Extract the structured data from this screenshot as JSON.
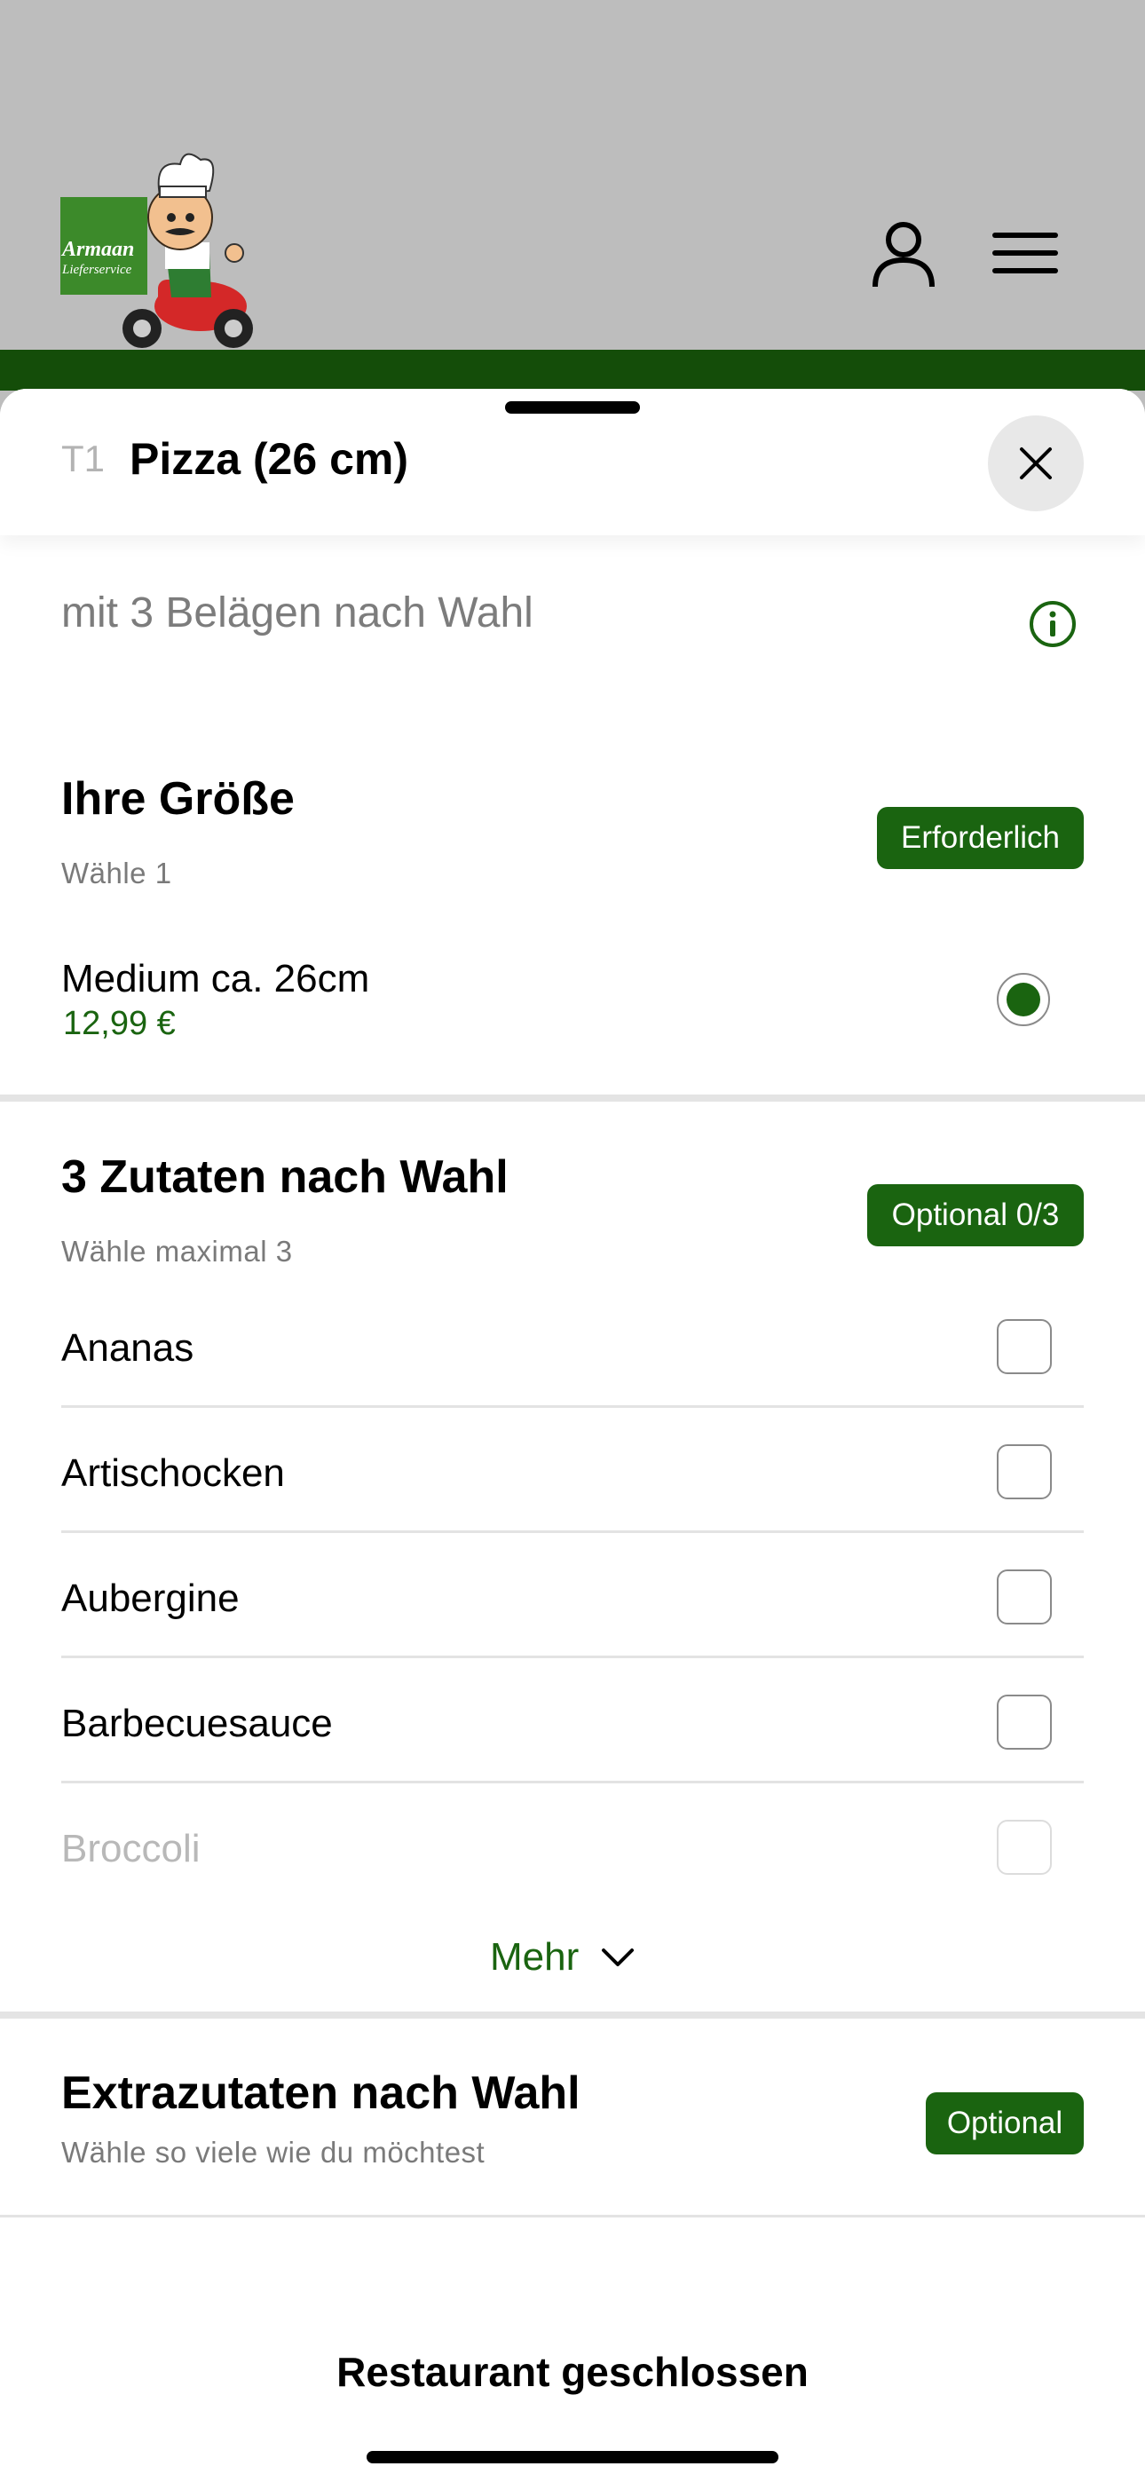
{
  "logo": {
    "line1": "Armaan",
    "line2": "Lieferservice"
  },
  "header": {
    "account_icon": "person-icon",
    "menu_icon": "hamburger-menu-icon"
  },
  "item": {
    "code": "T1",
    "title": "Pizza (26 cm)",
    "description": "mit 3 Belägen nach Wahl",
    "close_icon": "close-icon",
    "info_icon": "info-icon"
  },
  "size_section": {
    "title": "Ihre Größe",
    "subtitle": "Wähle 1",
    "badge": "Erforderlich",
    "options": [
      {
        "name": "Medium ca. 26cm",
        "price": "12,99 €",
        "selected": true
      }
    ]
  },
  "toppings_section": {
    "title": "3 Zutaten nach Wahl",
    "subtitle": "Wähle maximal 3",
    "badge": "Optional 0/3",
    "items": [
      {
        "label": "Ananas",
        "checked": false
      },
      {
        "label": "Artischocken",
        "checked": false
      },
      {
        "label": "Aubergine",
        "checked": false
      },
      {
        "label": "Barbecuesauce",
        "checked": false
      },
      {
        "label": "Broccoli",
        "checked": false
      }
    ],
    "more_label": "Mehr"
  },
  "extras_section": {
    "title": "Extrazutaten nach Wahl",
    "subtitle": "Wähle so viele wie du möchtest",
    "badge": "Optional"
  },
  "footer": {
    "status": "Restaurant geschlossen"
  },
  "colors": {
    "accent": "#1a6410",
    "header_bar": "#144d09",
    "background": "#bdbdbd"
  }
}
